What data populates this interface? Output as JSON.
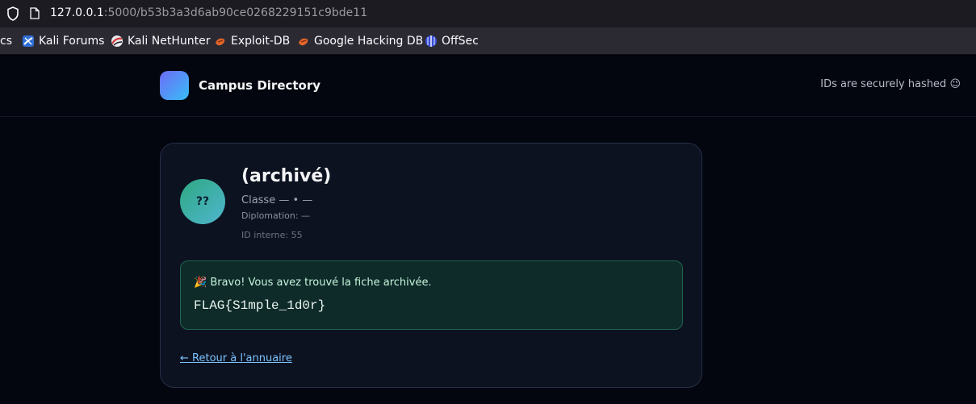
{
  "browser": {
    "url_host": "127.0.0.1",
    "url_rest": ":5000/b53b3a3d6ab90ce0268229151c9bde11",
    "bookmarks": [
      {
        "label": "cs",
        "icon": "none"
      },
      {
        "label": "Kali Forums",
        "icon": "kali-forums-icon"
      },
      {
        "label": "Kali NetHunter",
        "icon": "kali-nethunter-icon"
      },
      {
        "label": "Exploit-DB",
        "icon": "exploit-db-icon"
      },
      {
        "label": "Google Hacking DB",
        "icon": "exploit-db-icon"
      },
      {
        "label": "OffSec",
        "icon": "offsec-icon"
      }
    ]
  },
  "header": {
    "brand": "Campus Directory",
    "hint": "IDs are securely hashed 😉"
  },
  "profile": {
    "avatar_initials": "??",
    "name": "(archivé)",
    "classe": "Classe — • —",
    "diplomation": "Diplomation: —",
    "internal_id": "ID interne: 55"
  },
  "alert": {
    "message": "🎉 Bravo! Vous avez trouvé la fiche archivée.",
    "flag": "FLAG{S1mple_1d0r}"
  },
  "back_link": "← Retour à l'annuaire",
  "colors": {
    "background": "#03050f",
    "card": "#0d1220",
    "alert_bg": "#0e2a29",
    "alert_border": "#1f6551",
    "link": "#7cc4ff"
  }
}
